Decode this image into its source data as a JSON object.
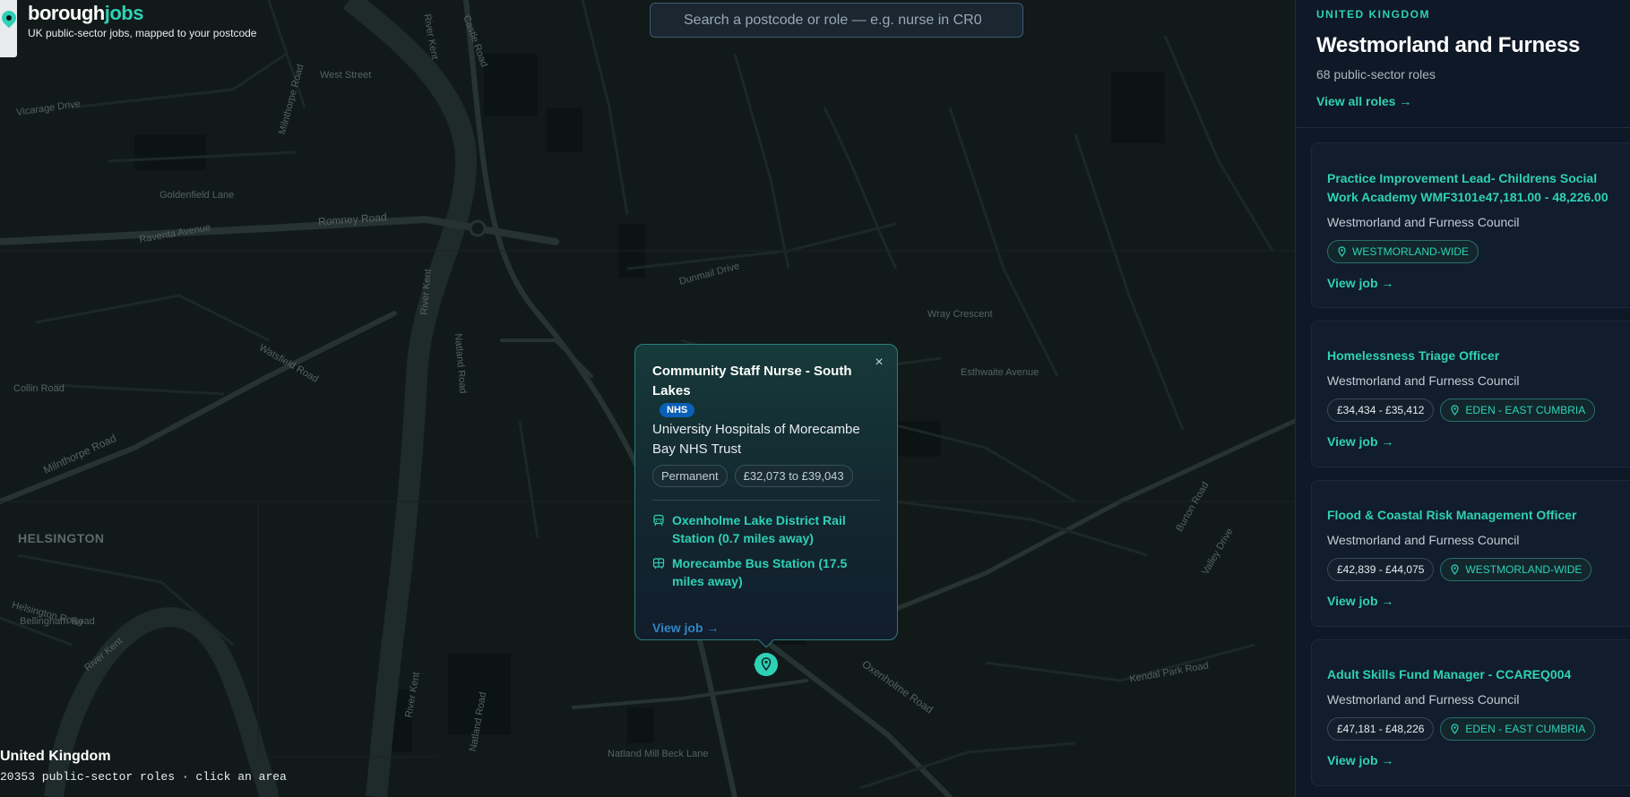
{
  "brand": {
    "name_part1": "borough",
    "name_part2": "jobs",
    "tagline": "UK public-sector jobs, mapped to your postcode"
  },
  "search": {
    "placeholder": "Search a postcode or role — e.g. nurse in CR0"
  },
  "map": {
    "area_label": "HELSINGTON",
    "street_labels": [
      "River Kent",
      "Castle Road",
      "Milnthorpe Road",
      "West Street",
      "Vicarage Drive",
      "Goldenfield Lane",
      "Romney Road",
      "Raventa Avenue",
      "River Kent",
      "Watsfield Road",
      "Milnthorpe Road",
      "Collin Road",
      "Helsington Road",
      "Bellingham Road",
      "River Kent",
      "River Kent",
      "Natland Road",
      "Natland Road",
      "Dunmail Drive",
      "Wray Crescent",
      "Esthwaite Avenue",
      "Oxenholme Road",
      "Kendal Park Road",
      "Natland Mill Beck Lane",
      "Burton Road",
      "Valley Drive"
    ]
  },
  "popup": {
    "title": "Community Staff Nurse - South Lakes",
    "badge": "NHS",
    "employer": "University Hospitals of Morecambe Bay NHS Trust",
    "contract": "Permanent",
    "salary": "£32,073 to £39,043",
    "stations": [
      {
        "icon": "train-icon",
        "text": "Oxenholme Lake District Rail Station (0.7 miles away)"
      },
      {
        "icon": "bus-icon",
        "text": "Morecambe Bus Station (17.5 miles away)"
      }
    ],
    "view_label": "View job →",
    "close_label": "×"
  },
  "map_info": {
    "region": "United Kingdom",
    "count_text": "20353 public-sector roles · click an area"
  },
  "sidebar": {
    "country": "UNITED KINGDOM",
    "title": "Westmorland and Furness",
    "roles_count": "68 public-sector roles",
    "view_all": "View all roles →",
    "jobs": [
      {
        "title": "Practice Improvement Lead- Childrens Social Work Academy WMF3101e47,181.00 - 48,226.00",
        "employer": "Westmorland and Furness Council",
        "salary": "",
        "location": "WESTMORLAND-WIDE",
        "view": "View job →"
      },
      {
        "title": "Homelessness Triage Officer",
        "employer": "Westmorland and Furness Council",
        "salary": "£34,434 - £35,412",
        "location": "EDEN - EAST CUMBRIA",
        "view": "View job →"
      },
      {
        "title": "Flood & Coastal Risk Management Officer",
        "employer": "Westmorland and Furness Council",
        "salary": "£42,839 - £44,075",
        "location": "WESTMORLAND-WIDE",
        "view": "View job →"
      },
      {
        "title": "Adult Skills Fund Manager - CCAREQ004",
        "employer": "Westmorland and Furness Council",
        "salary": "£47,181 - £48,226",
        "location": "EDEN - EAST CUMBRIA",
        "view": "View job →"
      }
    ]
  },
  "colors": {
    "accent": "#2fd1b6",
    "link_blue": "#2f86c7",
    "nhs_blue": "#0a5fb8",
    "panel_bg": "#0f1826",
    "map_bg": "#111a19"
  }
}
